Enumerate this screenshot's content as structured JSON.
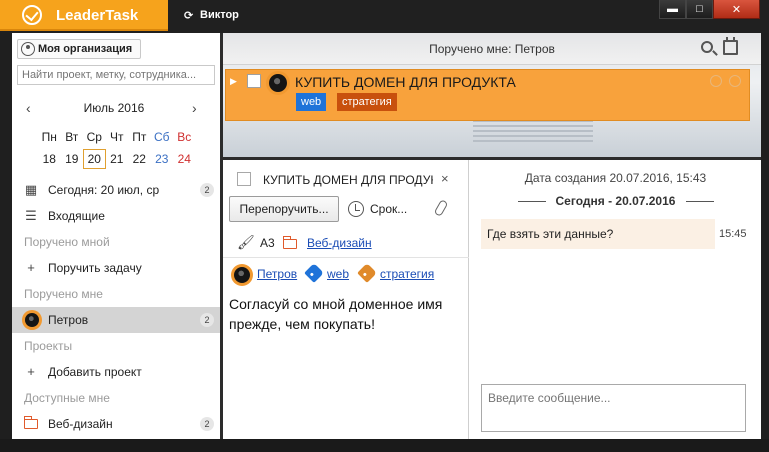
{
  "app": {
    "name": "LeaderTask",
    "user": "Виктор",
    "sync_glyph": "⟳",
    "accent": "#f6a31c"
  },
  "window_controls": {
    "minimize": "▬",
    "maximize": "□",
    "close": "✕"
  },
  "sidebar": {
    "org_button": "Моя организация",
    "search_placeholder": "Найти проект, метку, сотрудника...",
    "calendar": {
      "month": "Июль 2016",
      "prev": "‹",
      "next": "›",
      "weekdays": [
        "Пн",
        "Вт",
        "Ср",
        "Чт",
        "Пт",
        "Сб",
        "Вс"
      ],
      "days": [
        "18",
        "19",
        "20",
        "21",
        "22",
        "23",
        "24"
      ],
      "selected_day": "20"
    },
    "items": [
      {
        "label": "Сегодня: 20 июл, ср",
        "count": "2",
        "icon": "calendar-icon"
      },
      {
        "label": "Входящие",
        "icon": "inbox-icon"
      },
      {
        "label": "Поручено мной",
        "section": true
      },
      {
        "label": "Поручить задачу",
        "icon": "plus-icon",
        "icon_glyph": "+"
      },
      {
        "label": "Поручено мне",
        "section": true
      },
      {
        "label": "Петров",
        "count": "2",
        "icon": "avatar",
        "selected": true
      },
      {
        "label": "Проекты",
        "section": true
      },
      {
        "label": "Добавить проект",
        "icon": "plus-icon",
        "icon_glyph": "+"
      },
      {
        "label": "Доступные мне",
        "section": true
      },
      {
        "label": "Веб-дизайн",
        "count": "2",
        "icon": "folder-icon"
      }
    ]
  },
  "main": {
    "header_title": "Поручено мне: Петров",
    "task": {
      "arrow": "▶",
      "title": "КУПИТЬ ДОМЕН ДЛЯ ПРОДУКТА",
      "tags": [
        "web",
        "стратегия"
      ],
      "tag_colors": [
        "#1f73d9",
        "#c8500d"
      ],
      "bar_color": "#f8a23c"
    }
  },
  "detail": {
    "title": "КУПИТЬ ДОМЕН ДЛЯ ПРОДУКТА",
    "close": "×",
    "reassign_button": "Перепоручить...",
    "deadline_button": "Срок...",
    "priority": "A3",
    "project": "Веб-дизайн",
    "assignee": "Петров",
    "tags": [
      "web",
      "стратегия"
    ],
    "description": "Согласуй со мной доменное имя прежде, чем покупать!"
  },
  "chat": {
    "created": "Дата создания 20.07.2016, 15:43",
    "date_divider": "Сегодня - 20.07.2016",
    "message": "Где взять эти данные?",
    "message_time": "15:45",
    "input_placeholder": "Введите сообщение..."
  }
}
